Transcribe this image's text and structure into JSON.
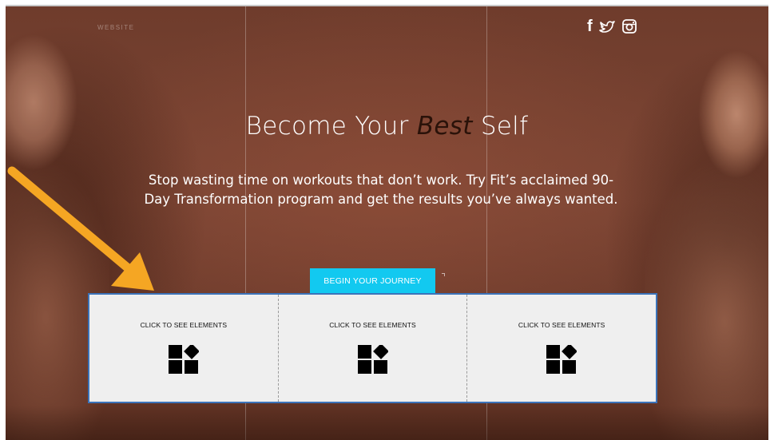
{
  "site": {
    "logo_text": "WEBSITE"
  },
  "social": [
    {
      "label": "f",
      "icon": "facebook-icon"
    },
    {
      "icon": "twitter-icon"
    },
    {
      "icon": "instagram-icon"
    }
  ],
  "hero": {
    "headline_before": "Become Your ",
    "headline_emphasis": "Best",
    "headline_after": " Self",
    "subtext": "Stop wasting time on workouts that don’t work. Try Fit’s acclaimed 90-Day Transformation program and get the results you’ve always wanted.",
    "cta_label": "BEGIN YOUR JOURNEY"
  },
  "strip": {
    "cells": [
      {
        "label": "CLICK TO SEE ELEMENTS",
        "icon": "add-elements-icon"
      },
      {
        "label": "CLICK TO SEE ELEMENTS",
        "icon": "add-elements-icon"
      },
      {
        "label": "CLICK TO SEE ELEMENTS",
        "icon": "add-elements-icon"
      }
    ]
  },
  "colors": {
    "cta": "#12c9f0",
    "selection_border": "#3b73b9",
    "arrow": "#f5a623",
    "headline_emphasis": "#2a1209"
  }
}
